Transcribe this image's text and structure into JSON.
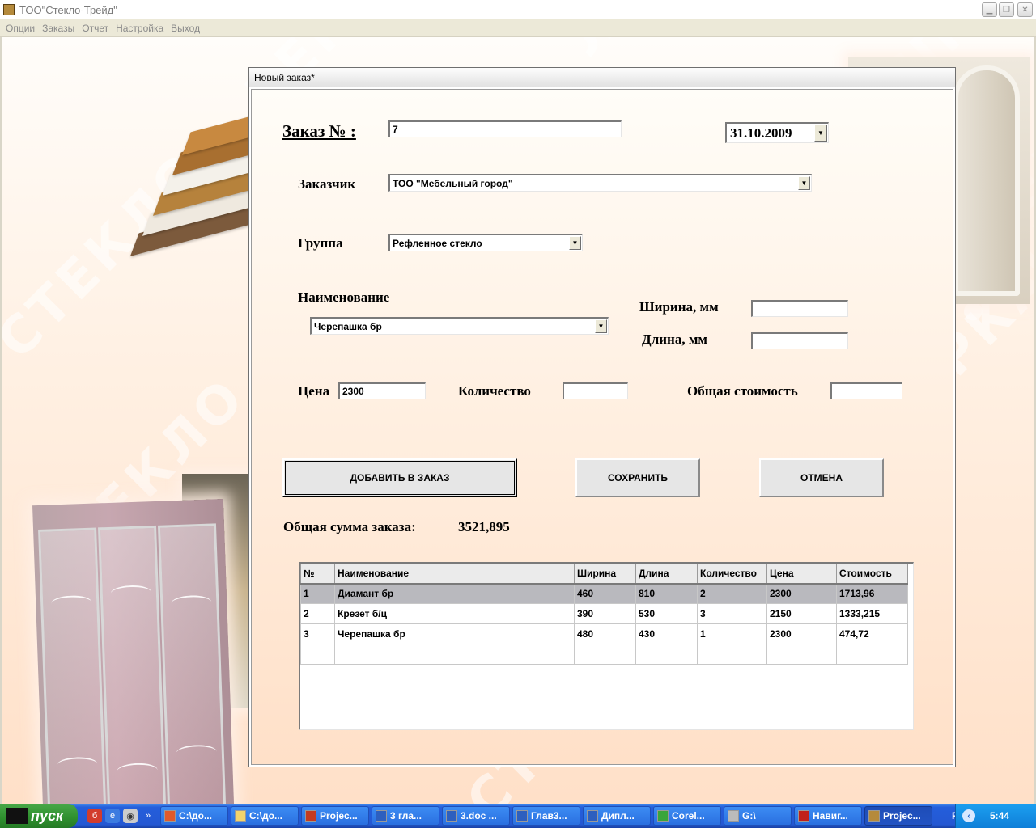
{
  "window": {
    "title": "ТОО\"Стекло-Трейд\""
  },
  "menu": [
    "Опции",
    "Заказы",
    "Отчет",
    "Настройка",
    "Выход"
  ],
  "watermark_text": "СТЕКЛО • ЗЕРКАЛО • ЛДСП",
  "dialog": {
    "title": "Новый заказ*",
    "order_label": "Заказ №  :",
    "order_number": "7",
    "date": "31.10.2009",
    "customer_label": "Заказчик",
    "customer_value": "ТОО \"Мебельный город\"",
    "group_label": "Группа",
    "group_value": "Рефленное стекло",
    "name_label": "Наименование",
    "name_value": "Черепашка бр",
    "width_label": "Ширина, мм",
    "width_value": "",
    "length_label": "Длина, мм",
    "length_value": "",
    "price_label": "Цена",
    "price_value": "2300",
    "quantity_label": "Количество",
    "quantity_value": "",
    "total_cost_label": "Общая стоимость",
    "total_cost_value": "",
    "add_button": "ДОБАВИТЬ В  ЗАКАЗ",
    "save_button": "СОХРАНИТЬ",
    "cancel_button": "ОТМЕНА",
    "order_sum_label": "Общая сумма заказа:",
    "order_sum_value": "3521,895",
    "grid": {
      "columns": [
        "№",
        "Наименование",
        "Ширина",
        "Длина",
        "Количество",
        "Цена",
        "Стоимость"
      ],
      "rows": [
        [
          "1",
          "Диамант бр",
          "460",
          "810",
          "2",
          "2300",
          "1713,96"
        ],
        [
          "2",
          "Крезет б/ц",
          "390",
          "530",
          "3",
          "2150",
          "1333,215"
        ],
        [
          "3",
          "Черепашка бр",
          "480",
          "430",
          "1",
          "2300",
          "474,72"
        ],
        [
          "",
          "",
          "",
          "",
          "",
          "",
          ""
        ]
      ],
      "selected_row": 0
    }
  },
  "taskbar": {
    "start_label": "пуск",
    "tasks": [
      "C:\\до...",
      "C:\\до...",
      "Projec...",
      "3 гла...",
      "3.doc ...",
      "Глав3...",
      "Дипл...",
      "Corel...",
      "G:\\",
      "Навиг...",
      "Projec..."
    ],
    "active_task": 10,
    "language": "RU",
    "clock": "5:44"
  },
  "colors": {
    "accent_taskbar": "#245edb",
    "start_green": "#2e8f2e",
    "background_peach": "#ffe0c8"
  }
}
